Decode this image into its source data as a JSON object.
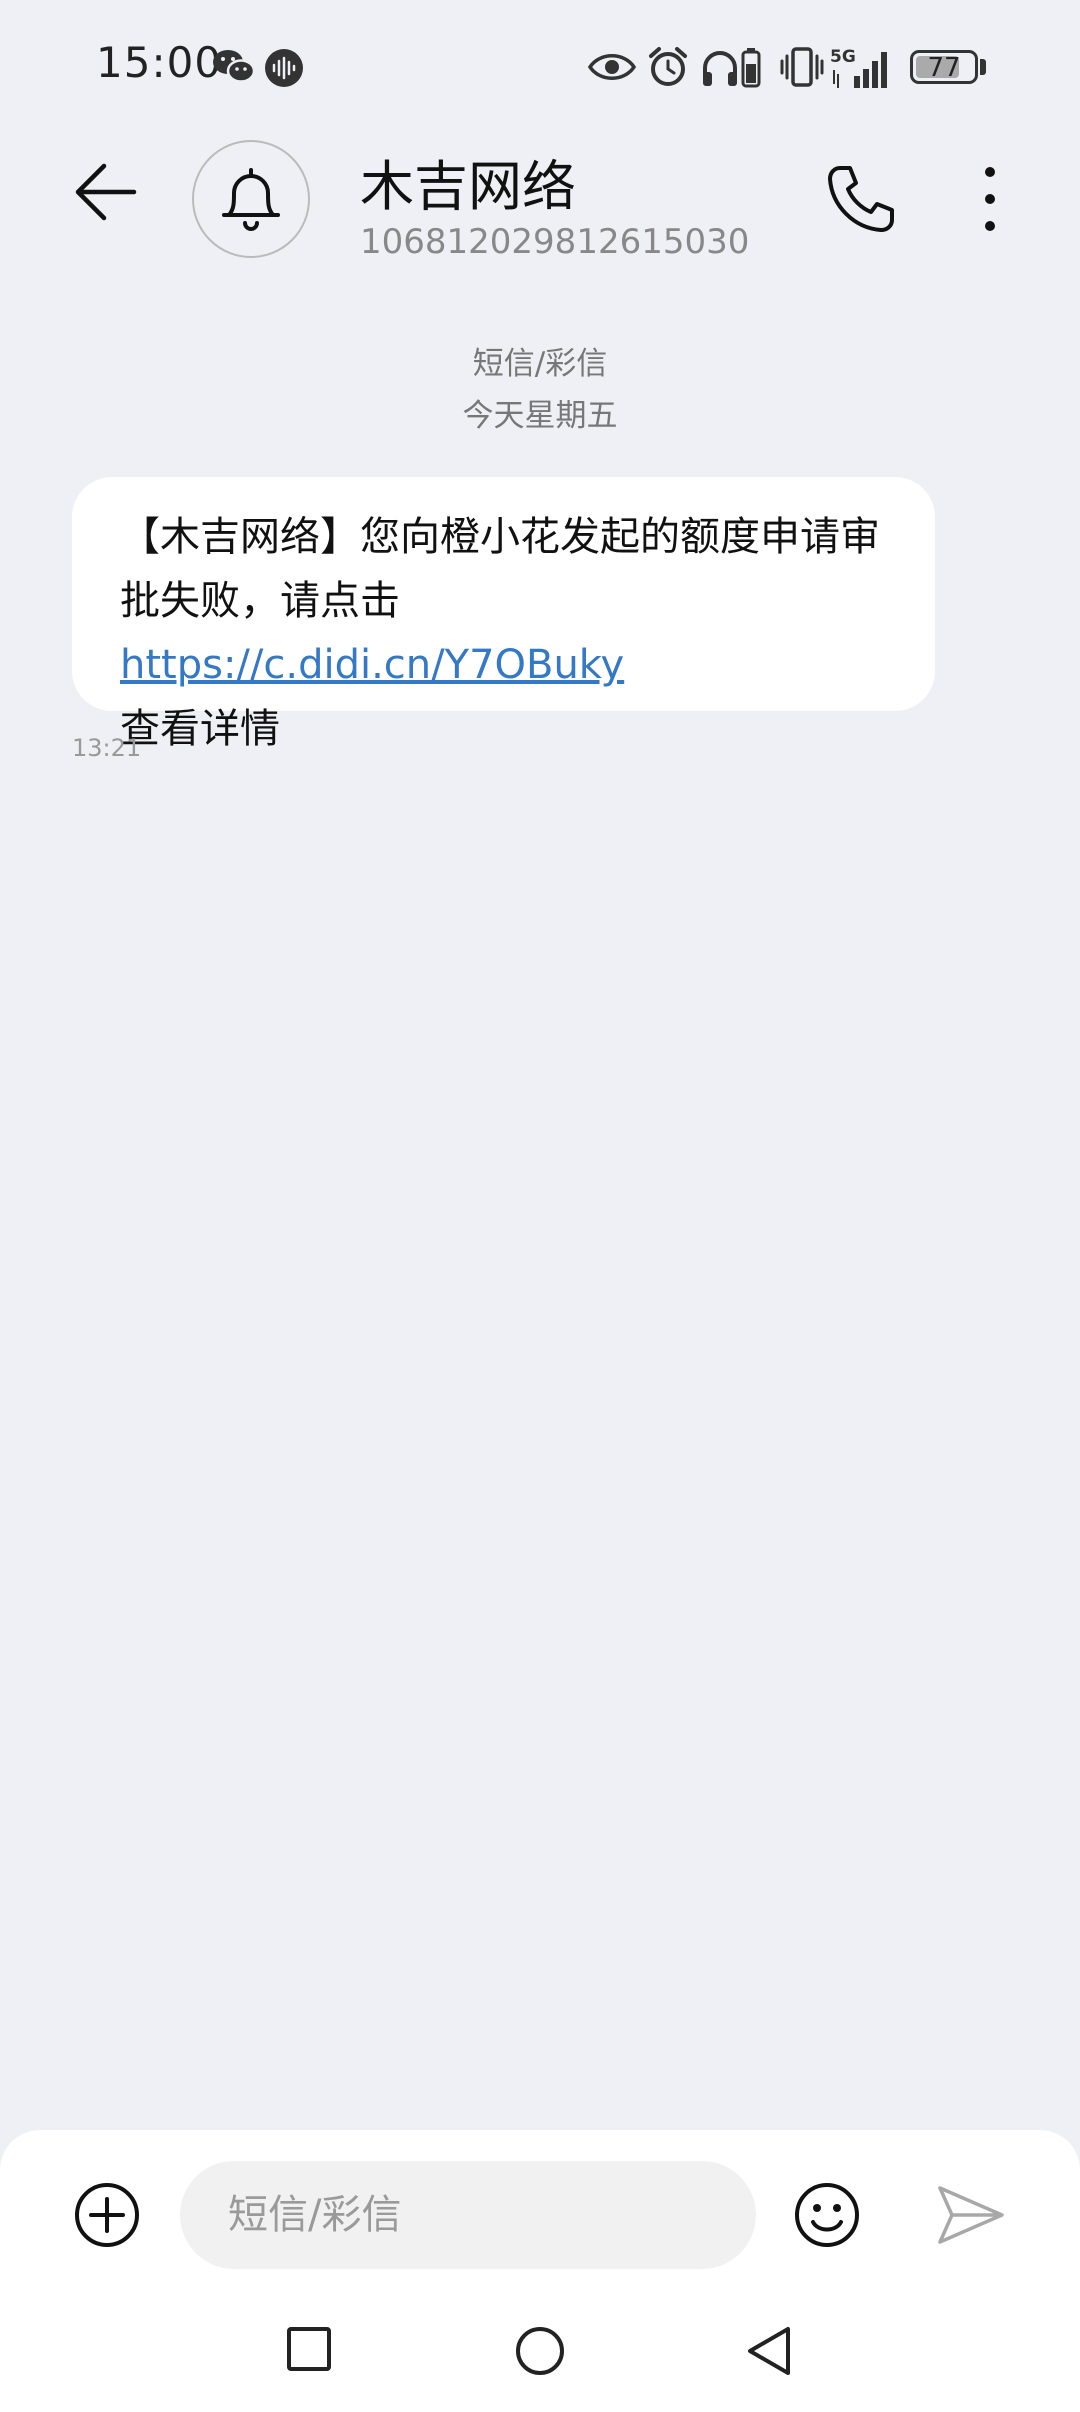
{
  "status_bar": {
    "time": "15:00",
    "battery": "77",
    "battery_level": 0.77,
    "network": "5G",
    "icons": [
      "wechat-icon",
      "voice-recorder-icon",
      "eye-comfort-icon",
      "alarm-icon",
      "headphones-icon",
      "headphone-battery-icon",
      "vibrate-icon",
      "5g-signal-icon",
      "battery-icon"
    ]
  },
  "header": {
    "title": "木吉网络",
    "number": "106812029812615030",
    "back_icon": "arrow-left-icon",
    "avatar_icon": "bell-icon",
    "call_icon": "phone-icon",
    "more_icon": "more-vertical-icon"
  },
  "thread": {
    "message_type": "短信/彩信",
    "date": "今天星期五",
    "messages": [
      {
        "text_before": "【木吉网络】您向橙小花发起的额度申请审批失败，请点击",
        "link": "https://c.didi.cn/Y7OBuky",
        "text_after": "查看详情",
        "time": "13:21"
      }
    ]
  },
  "composer": {
    "placeholder": "短信/彩信",
    "value": "",
    "add_icon": "plus-circle-icon",
    "emoji_icon": "smiley-icon",
    "send_icon": "send-icon"
  },
  "nav_bar": {
    "recent_icon": "square-icon",
    "home_icon": "circle-icon",
    "back_icon": "triangle-back-icon"
  }
}
